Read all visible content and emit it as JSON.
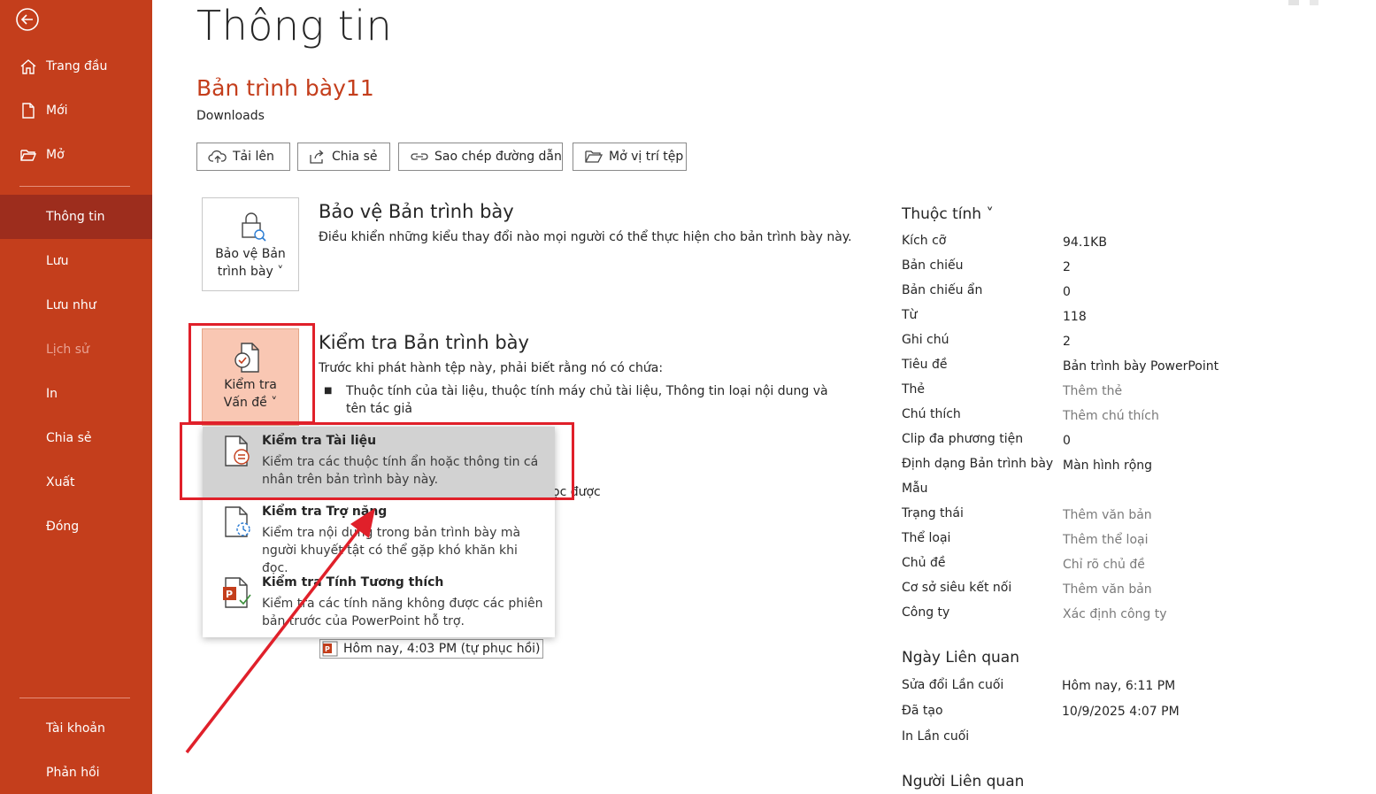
{
  "sidebar": {
    "items": [
      {
        "label": "Trang đầu"
      },
      {
        "label": "Mới"
      },
      {
        "label": "Mở"
      },
      {
        "label": "Thông tin"
      },
      {
        "label": "Lưu"
      },
      {
        "label": "Lưu như"
      },
      {
        "label": "Lịch sử"
      },
      {
        "label": "In"
      },
      {
        "label": "Chia sẻ"
      },
      {
        "label": "Xuất"
      },
      {
        "label": "Đóng"
      },
      {
        "label": "Tài khoản"
      },
      {
        "label": "Phản hồi"
      }
    ],
    "colors": {
      "bg": "#c43e1c",
      "active": "#9d2d1d"
    }
  },
  "main": {
    "title": "Thông tin",
    "doc_name": "Bản trình bày11",
    "doc_location": "Downloads",
    "toolbar": {
      "upload": "Tải lên",
      "share": "Chia sẻ",
      "copy_path": "Sao chép đường dẫn",
      "open_location": "Mở vị trí tệp"
    },
    "protect": {
      "button_line1": "Bảo vệ Bản",
      "button_line2": "trình bày ˅",
      "title": "Bảo vệ Bản trình bày",
      "desc": "Điều khiển những kiểu thay đổi nào mọi người có thể thực hiện cho bản trình bày này."
    },
    "inspect": {
      "button_line1": "Kiểm tra",
      "button_line2": "Vấn đề ˅",
      "title": "Kiểm tra Bản trình bày",
      "desc": "Trước khi phát hành tệp này, phải biết rằng nó có chứa:",
      "bullet": "Thuộc tính của tài liệu, thuộc tính máy chủ tài liệu, Thông tin loại nội dung và tên tác giả"
    },
    "behind_text": "ọc được",
    "version_text": "Hôm nay, 4:03 PM (tự phục hồi)"
  },
  "menu": {
    "items": [
      {
        "title": "Kiểm tra Tài liệu",
        "desc": "Kiểm tra các thuộc tính ẩn hoặc thông tin cá nhân trên bản trình bày này."
      },
      {
        "title": "Kiểm tra Trợ năng",
        "desc": "Kiểm tra nội dung trong bản trình bày mà người khuyết tật có thể gặp khó khăn khi đọc."
      },
      {
        "title": "Kiểm tra Tính Tương thích",
        "desc": "Kiểm tra các tính năng không được các phiên bản trước của PowerPoint hỗ trợ."
      }
    ]
  },
  "properties": {
    "title": "Thuộc tính ˅",
    "rows": [
      {
        "k": "Kích cỡ",
        "v": "94.1KB"
      },
      {
        "k": "Bản chiếu",
        "v": "2"
      },
      {
        "k": "Bản chiếu ẩn",
        "v": "0"
      },
      {
        "k": "Từ",
        "v": "118"
      },
      {
        "k": "Ghi chú",
        "v": "2"
      },
      {
        "k": "Tiêu đề",
        "v": "Bản trình bày PowerPoint"
      },
      {
        "k": "Thẻ",
        "v": "Thêm thẻ"
      },
      {
        "k": "Chú thích",
        "v": "Thêm chú thích"
      },
      {
        "k": "Clip đa phương tiện",
        "v": "0"
      },
      {
        "k": "Định dạng Bản trình bày",
        "v": "Màn hình rộng"
      },
      {
        "k": "Mẫu",
        "v": ""
      },
      {
        "k": "Trạng thái",
        "v": "Thêm văn bản"
      },
      {
        "k": "Thể loại",
        "v": "Thêm thể loại"
      },
      {
        "k": "Chủ đề",
        "v": "Chỉ rõ chủ đề"
      },
      {
        "k": "Cơ sở siêu kết nối",
        "v": "Thêm văn bản"
      },
      {
        "k": "Công ty",
        "v": "Xác định công ty"
      }
    ]
  },
  "dates": {
    "title": "Ngày Liên quan",
    "rows": [
      {
        "k": "Sửa đổi Lần cuối",
        "v": "Hôm nay, 6:11 PM"
      },
      {
        "k": "Đã tạo",
        "v": "10/9/2025 4:07 PM"
      },
      {
        "k": "In Lần cuối",
        "v": ""
      }
    ]
  },
  "people": {
    "title": "Người Liên quan"
  },
  "annotation": {
    "color": "#e0202a"
  }
}
